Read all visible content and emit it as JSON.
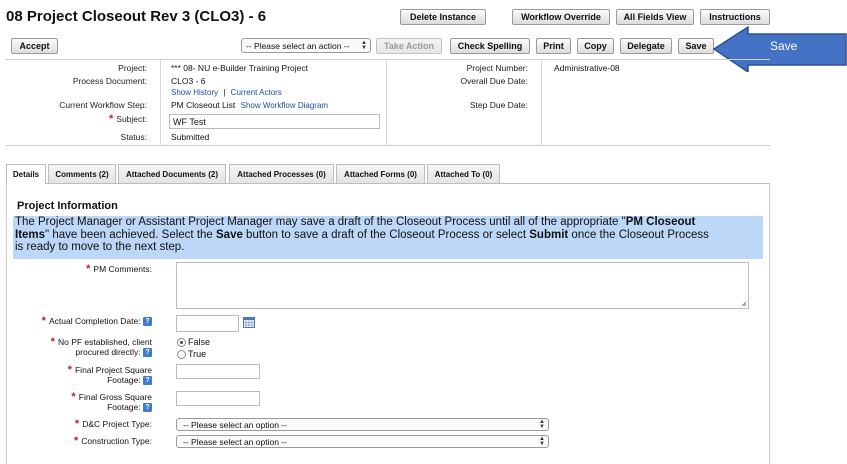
{
  "page": {
    "title": "08 Project Closeout Rev 3 (CLO3) - 6"
  },
  "top_buttons": {
    "delete": "Delete Instance",
    "override": "Workflow Override",
    "all_fields": "All Fields View",
    "instructions": "Instructions"
  },
  "toolbar": {
    "accept": "Accept",
    "action_placeholder": "-- Please select an action --",
    "take_action": "Take Action",
    "check_spelling": "Check Spelling",
    "print": "Print",
    "copy": "Copy",
    "delegate": "Delegate",
    "save": "Save"
  },
  "callout": {
    "label": "Save",
    "color": "#4472c4"
  },
  "header": {
    "project_label": "Project:",
    "project_value": "*** 08- NU e-Builder Training Project",
    "process_doc_label": "Process Document:",
    "process_doc_value": "CLO3 - 6",
    "show_history": "Show History",
    "separator": "|",
    "current_actors": "Current Actors",
    "workflow_step_label": "Current Workflow Step:",
    "workflow_step_value": "PM Closeout List",
    "show_workflow_diagram": "Show Workflow Diagram",
    "subject_label": "Subject:",
    "subject_value": "WF Test",
    "status_label": "Status:",
    "status_value": "Submitted",
    "project_number_label": "Project Number:",
    "project_number_value": "Administrative-08",
    "overall_due_label": "Overall Due Date:",
    "step_due_label": "Step Due Date:"
  },
  "tabs": [
    {
      "label": "Details"
    },
    {
      "label": "Comments (2)"
    },
    {
      "label": "Attached Documents (2)"
    },
    {
      "label": "Attached Processes (0)"
    },
    {
      "label": "Attached Forms (0)"
    },
    {
      "label": "Attached To (0)"
    }
  ],
  "section": {
    "title": "Project Information",
    "info_line1_a": "The Project Manager or Assistant Project Manager may save a draft of the Closeout Process until all of the appropriate \"",
    "info_line1_b": "PM Closeout",
    "info_line2_a": "Items",
    "info_line2_b": "\" have been achieved. Select the ",
    "info_line2_c": "Save",
    "info_line2_d": " button to save a draft of the Closeout Process or select ",
    "info_line2_e": "Submit",
    "info_line2_f": " once the Closeout Process",
    "info_line3": "is ready to move to the next step."
  },
  "form": {
    "pm_comments": "PM Comments:",
    "actual_completion": "Actual Completion Date:",
    "no_pf_line1": "No PF established, client",
    "no_pf_line2": "procured directly:",
    "radio_false": "False",
    "radio_true": "True",
    "final_proj_sq_line1": "Final Project Square",
    "final_proj_sq_line2": "Footage:",
    "final_gross_sq_line1": "Final Gross Square",
    "final_gross_sq_line2": "Footage:",
    "dc_project_type": "D&C Project Type:",
    "construction_type": "Construction Type:",
    "select_placeholder": "-- Please select an option --"
  }
}
